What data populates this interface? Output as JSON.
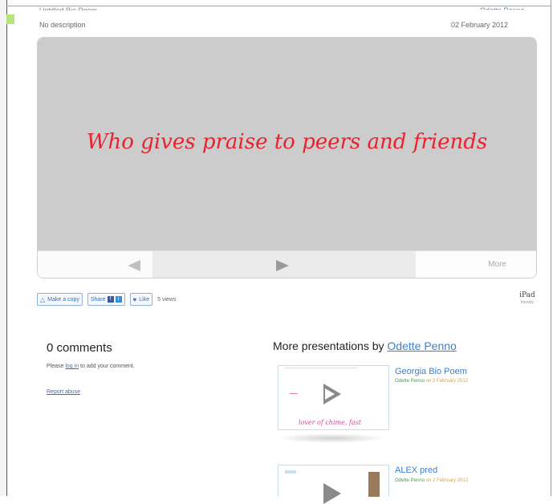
{
  "header": {
    "title_cut": "Untitled Bio Poem",
    "author_cut": "Odette Penno",
    "description": "No description",
    "date": "02 February 2012"
  },
  "slide": {
    "text": "Who gives praise to peers and friends",
    "text_color": "#e8222e",
    "background": "#cccccc",
    "controls": {
      "prev_icon": "triangle-left-icon",
      "next_icon": "triangle-right-icon",
      "more_label": "More"
    }
  },
  "actions": {
    "make_copy": "Make a copy",
    "share": "Share",
    "share_fb": "f",
    "share_tw": "t",
    "like": "Like",
    "views": "5 views",
    "ipad": "iPad",
    "ipad_sub": "friendly"
  },
  "comments": {
    "title": "0 comments",
    "please": "Please",
    "login_link": "log in",
    "add_text": "to add your comment.",
    "report_abuse": "Report abuse"
  },
  "more_presentations": {
    "heading": "More presentations by",
    "author": "Odette Penno",
    "items": [
      {
        "title": "Georgia Bio Poem",
        "author": "Odette Penno",
        "date_text": "on 2 February 2012",
        "thumb_caption": "lover of chime, fast"
      },
      {
        "title": "ALEX pred",
        "author": "Odette Penno",
        "date_text": "on 2 February 2012"
      }
    ]
  },
  "colors": {
    "link": "#3a7fd0",
    "accent_green": "#b8e27a",
    "meta_orange": "#e0a040"
  }
}
